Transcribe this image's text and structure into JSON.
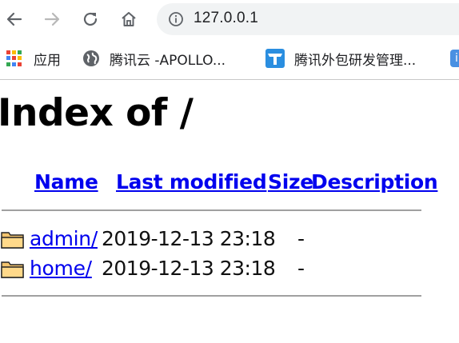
{
  "browser": {
    "url": "127.0.0.1",
    "bookmarks": [
      {
        "label": "应用",
        "icon": "apps-grid-icon"
      },
      {
        "label": "腾讯云 -APOLLO...",
        "icon": "globe-icon"
      },
      {
        "label": "腾讯外包研发管理...",
        "icon": "tencent-t-icon"
      }
    ]
  },
  "page": {
    "title": "Index of /",
    "columns": {
      "name": "Name",
      "last_modified": "Last modified",
      "size": "Size",
      "description": "Description"
    },
    "rows": [
      {
        "name": "admin/",
        "modified": "2019-12-13 23:18",
        "size": "-",
        "icon": "folder-icon"
      },
      {
        "name": "home/",
        "modified": "2019-12-13 23:18",
        "size": "-",
        "icon": "folder-icon"
      }
    ]
  },
  "colors": {
    "link": "#0000ee",
    "omnibox_bg": "#f1f3f4"
  }
}
